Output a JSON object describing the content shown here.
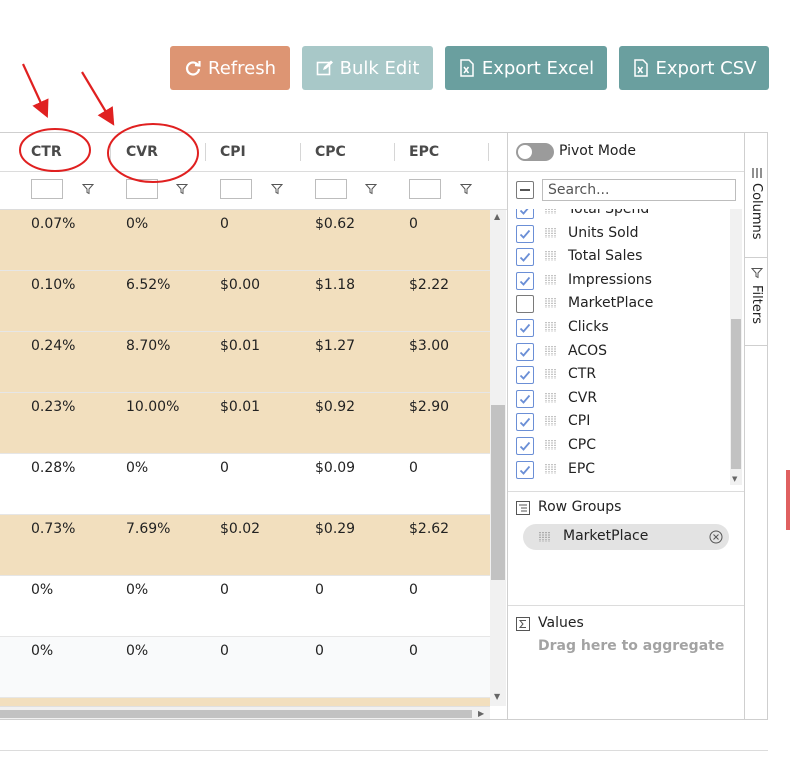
{
  "toolbar": {
    "refresh_label": "Refresh",
    "bulk_edit_label": "Bulk Edit",
    "export_excel_label": "Export Excel",
    "export_csv_label": "Export CSV"
  },
  "grid": {
    "columns": [
      "CTR",
      "CVR",
      "CPI",
      "CPC",
      "EPC"
    ],
    "rows": [
      {
        "ctr": "0.07%",
        "cvr": "0%",
        "cpi": "0",
        "cpc": "$0.62",
        "epc": "0",
        "highlight": true
      },
      {
        "ctr": "0.10%",
        "cvr": "6.52%",
        "cpi": "$0.00",
        "cpc": "$1.18",
        "epc": "$2.22",
        "highlight": true
      },
      {
        "ctr": "0.24%",
        "cvr": "8.70%",
        "cpi": "$0.01",
        "cpc": "$1.27",
        "epc": "$3.00",
        "highlight": true
      },
      {
        "ctr": "0.23%",
        "cvr": "10.00%",
        "cpi": "$0.01",
        "cpc": "$0.92",
        "epc": "$2.90",
        "highlight": true
      },
      {
        "ctr": "0.28%",
        "cvr": "0%",
        "cpi": "0",
        "cpc": "$0.09",
        "epc": "0",
        "highlight": false
      },
      {
        "ctr": "0.73%",
        "cvr": "7.69%",
        "cpi": "$0.02",
        "cpc": "$0.29",
        "epc": "$2.62",
        "highlight": true
      },
      {
        "ctr": "0%",
        "cvr": "0%",
        "cpi": "0",
        "cpc": "0",
        "epc": "0",
        "highlight": false
      },
      {
        "ctr": "0%",
        "cvr": "0%",
        "cpi": "0",
        "cpc": "0",
        "epc": "0",
        "highlight": false
      }
    ]
  },
  "panel": {
    "pivot_mode_label": "Pivot Mode",
    "search_placeholder": "Search...",
    "columns": [
      {
        "label": "Total Spend",
        "checked": true
      },
      {
        "label": "Units Sold",
        "checked": true
      },
      {
        "label": "Total Sales",
        "checked": true
      },
      {
        "label": "Impressions",
        "checked": true
      },
      {
        "label": "MarketPlace",
        "checked": false
      },
      {
        "label": "Clicks",
        "checked": true
      },
      {
        "label": "ACOS",
        "checked": true
      },
      {
        "label": "CTR",
        "checked": true
      },
      {
        "label": "CVR",
        "checked": true
      },
      {
        "label": "CPI",
        "checked": true
      },
      {
        "label": "CPC",
        "checked": true
      },
      {
        "label": "EPC",
        "checked": true
      }
    ],
    "row_groups_label": "Row Groups",
    "row_group_chip": "MarketPlace",
    "values_label": "Values",
    "values_hint": "Drag here to aggregate"
  },
  "side_tabs": {
    "columns_label": "Columns",
    "filters_label": "Filters"
  },
  "colors": {
    "refresh": "#dd9573",
    "bulk_edit": "#a8c8c8",
    "export": "#6a9f9f",
    "row_highlight": "#f2dfbe",
    "checkbox": "#6b8fd6",
    "annotation": "#e02020"
  }
}
